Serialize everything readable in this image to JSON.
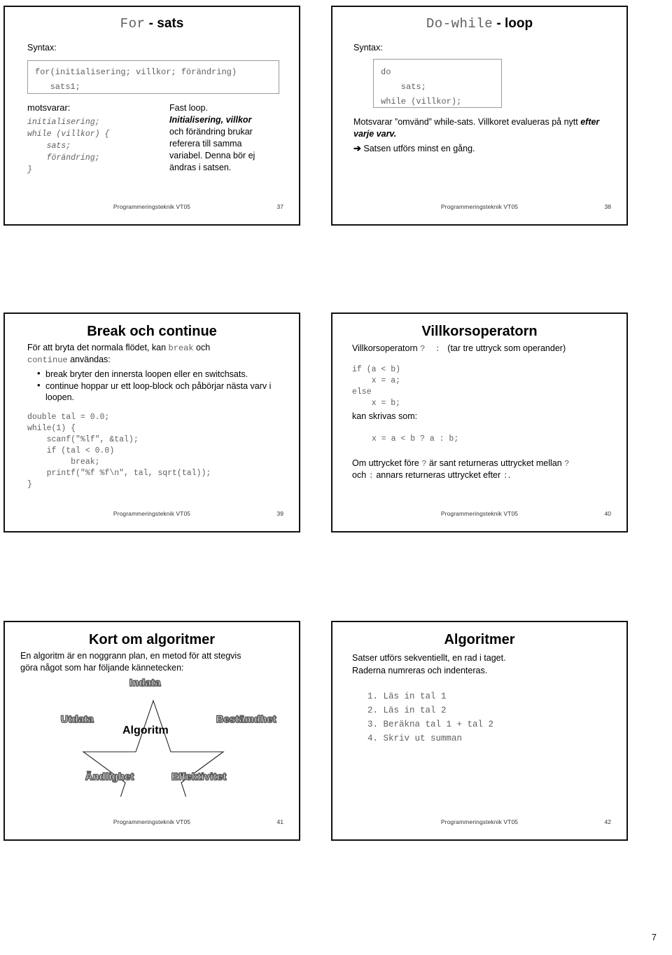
{
  "document": {
    "page_number": "7",
    "footer_text": "Programmeringsteknik VT05"
  },
  "slides": [
    {
      "id": "for-sats",
      "number": "37",
      "title_mono": "For",
      "title_rest": "- sats",
      "syntax_label": "Syntax:",
      "code_box": "for(initialisering; villkor; förändring)\n   sats1;",
      "left_col": {
        "heading": "motsvarar:",
        "code": "initialisering;\nwhile (villkor) {\n    sats;\n    förändring;\n}"
      },
      "right_col": {
        "line1": "Fast loop.",
        "line2": "Initialisering, villkor",
        "line3": "och förändring brukar",
        "line4": "referera till samma",
        "line5": "variabel. Denna bör ej",
        "line6": "ändras i satsen."
      }
    },
    {
      "id": "do-while-loop",
      "number": "38",
      "title_mono": "Do-while",
      "title_rest": "- loop",
      "syntax_label": "Syntax:",
      "code_box": "do\n    sats;\nwhile (villkor);",
      "para1_a": "Motsvarar ”omvänd” while-sats. Villkoret evalueras på nytt ",
      "para1_b": "efter varje varv.",
      "para2_arrow": "➔",
      "para2": "Satsen utförs minst en gång."
    },
    {
      "id": "break-och-continue",
      "number": "39",
      "title": "Break och continue",
      "intro_a": "För att bryta det normala flödet, kan ",
      "intro_mono1": "break",
      "intro_b": " och",
      "intro_mono2": "continue",
      "intro_c": " användas:",
      "bullets": [
        "break bryter den innersta loopen eller en switchsats.",
        "continue hoppar ur ett loop-block och påbörjar nästa varv i loopen."
      ],
      "code": "double tal = 0.0;\nwhile(1) {\n    scanf(\"%lf\", &tal);\n    if (tal < 0.0)\n         break;\n    printf(\"%f %f\\n\", tal, sqrt(tal));\n}"
    },
    {
      "id": "villkorsoperatorn",
      "number": "40",
      "title": "Villkorsoperatorn",
      "line1_a": "Villkorsoperatorn",
      "line1_ops": "?  :",
      "line1_b": "(tar tre uttryck som operander)",
      "code1": "if (a < b)\n    x = a;\nelse\n    x = b;",
      "mid_text": "kan skrivas som:",
      "code2": "x = a < b ? a : b;",
      "tail_1a": "Om uttrycket före ",
      "tail_op1": "?",
      "tail_1b": " är sant returneras uttrycket mellan ",
      "tail_op2": "?",
      "tail_2a": "och  ",
      "tail_op3": ":",
      "tail_2b": " annars returneras uttrycket efter ",
      "tail_op4": ":",
      "tail_2c": "."
    },
    {
      "id": "kort-om-algoritmer",
      "number": "41",
      "title": "Kort om algoritmer",
      "intro_line1": "En algoritm är en noggrann plan, en metod för att stegvis",
      "intro_line2": "göra något som har följande kännetecken:",
      "star": {
        "center_label": "Algoritm",
        "points": [
          {
            "label": "Indata",
            "position": "top"
          },
          {
            "label": "Bestämdhet",
            "position": "right"
          },
          {
            "label": "Effektivitet",
            "position": "bottom-right"
          },
          {
            "label": "Ändlighet",
            "position": "bottom-left"
          },
          {
            "label": "Utdata",
            "position": "left"
          }
        ]
      }
    },
    {
      "id": "algoritmer",
      "number": "42",
      "title": "Algoritmer",
      "line1": "Satser utförs sekventiellt, en rad i taget.",
      "line2": "Raderna numreras och indenteras.",
      "steps": [
        "1. Läs in tal 1",
        "2. Läs in tal 2",
        "3. Beräkna tal 1 + tal 2",
        "4. Skriv ut summan"
      ]
    }
  ],
  "colors": {
    "frame": "#111111",
    "code_text": "#5f5f5f",
    "codebox_border": "#9a9a9a",
    "footer_text": "#333333"
  }
}
